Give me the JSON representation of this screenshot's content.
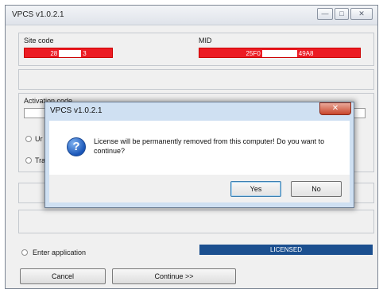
{
  "window": {
    "title": "VPCS v1.0.2.1",
    "controls": [
      "—",
      "□",
      "✕"
    ]
  },
  "fields": {
    "site_code_label": "Site code",
    "site_code_left": "28",
    "site_code_right": "3",
    "mid_label": "MID",
    "mid_left": "25F0",
    "mid_right": "49A8"
  },
  "activation": {
    "label": "Activation code"
  },
  "options": {
    "opt_1_partial": "Ur",
    "opt_2_partial": "Tra",
    "enter_application": "Enter application"
  },
  "status": {
    "text": "LICENSED"
  },
  "buttons": {
    "cancel": "Cancel",
    "continue": "Continue >>"
  },
  "dialog": {
    "title": "VPCS v1.0.2.1",
    "close": "✕",
    "icon_glyph": "?",
    "message": "License will be permanently removed from this computer! Do you want to continue?",
    "yes": "Yes",
    "no": "No"
  },
  "colors": {
    "red_field": "#ec1c24",
    "status_blue": "#1b4f8f",
    "dialog_frame": "#cfe0f2"
  }
}
